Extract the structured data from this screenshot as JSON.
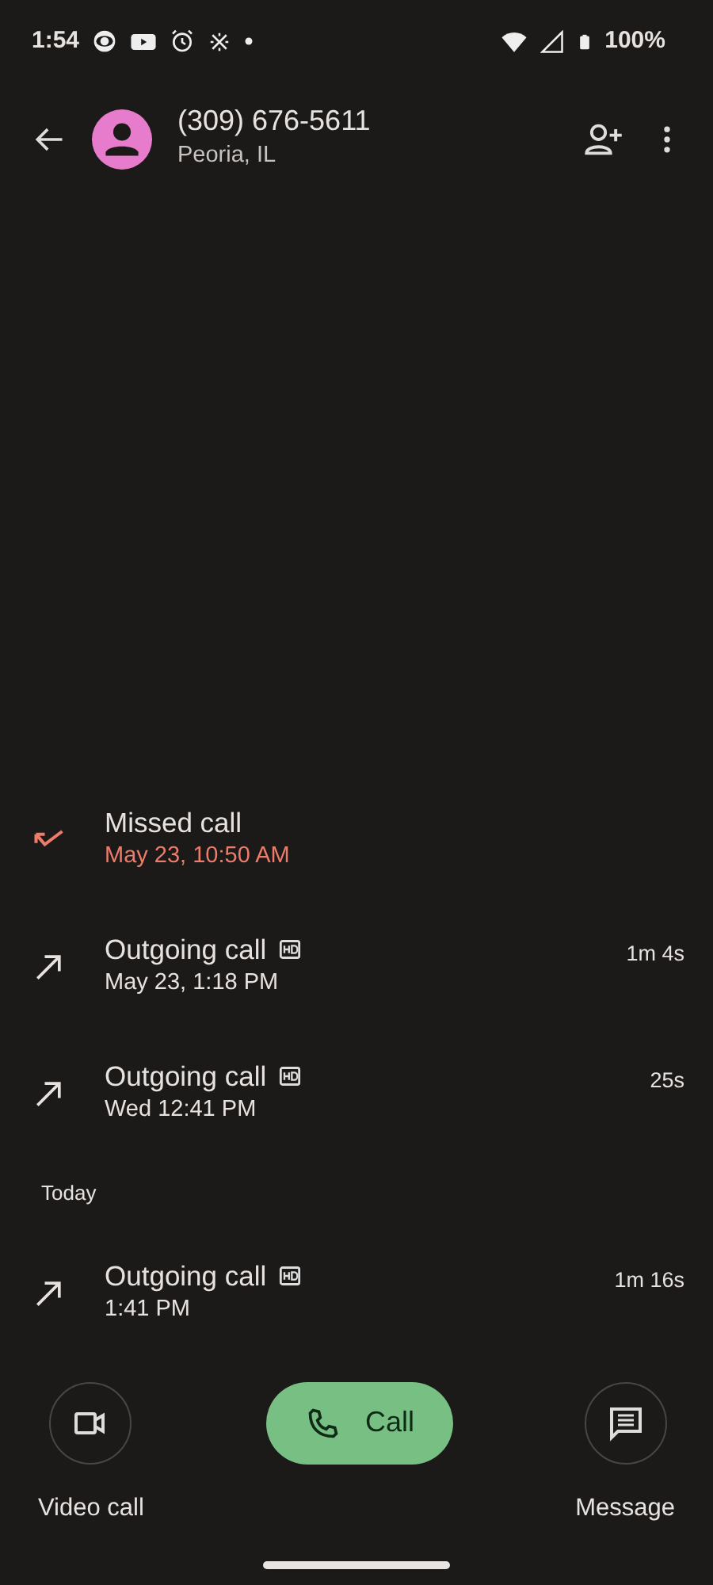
{
  "status_bar": {
    "time": "1:54",
    "battery": "100%"
  },
  "contact": {
    "number": "(309) 676-5611",
    "location": "Peoria, IL"
  },
  "history": [
    {
      "kind": "missed",
      "title": "Missed call",
      "hd": false,
      "when": "May 23, 10:50 AM"
    },
    {
      "kind": "outgoing",
      "title": "Outgoing call",
      "hd": true,
      "when": "May 23, 1:18 PM",
      "duration": "1m 4s"
    },
    {
      "kind": "outgoing",
      "title": "Outgoing call",
      "hd": true,
      "when": "Wed 12:41 PM",
      "duration": "25s"
    },
    {
      "kind": "heading",
      "label": "Today"
    },
    {
      "kind": "outgoing",
      "title": "Outgoing call",
      "hd": true,
      "when": "1:41 PM",
      "duration": "1m 16s"
    }
  ],
  "actions": {
    "video": "Video call",
    "call": "Call",
    "message": "Message"
  }
}
